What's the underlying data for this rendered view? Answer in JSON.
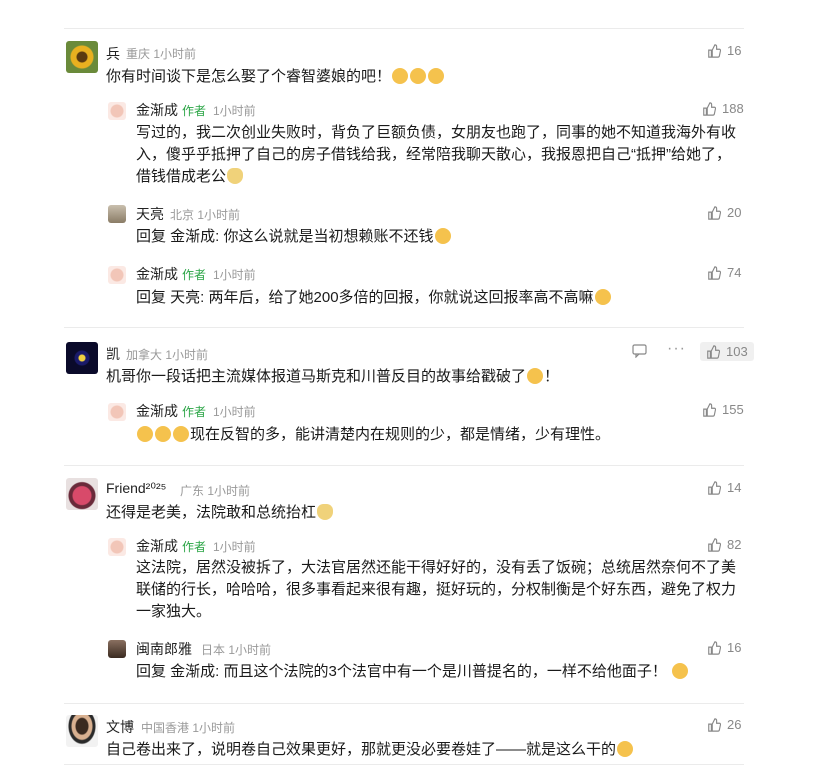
{
  "comments": [
    {
      "name": "兵",
      "location": "重庆",
      "time": "1小时前",
      "likes": "16",
      "text": "你有时间谈下是怎么娶了个睿智婆娘的吧！",
      "replies": [
        {
          "name": "金渐成",
          "tag": "作者",
          "time": "1小时前",
          "likes": "188",
          "lines": [
            "写过的，我二次创业失败时，背负了巨额负债，女朋友也跑了，同事的她不知道我海外有收",
            "入，傻乎乎抵押了自己的房子借钱给我，经常陪我聊天散心，我报恩把自己“抵押”给她了，",
            "借钱借成老公"
          ]
        },
        {
          "name": "天亮",
          "location": "北京",
          "time": "1小时前",
          "likes": "20",
          "reply_prefix": "回复 金渐成:",
          "text": "你这么说就是当初想赖账不还钱"
        },
        {
          "name": "金渐成",
          "tag": "作者",
          "time": "1小时前",
          "likes": "74",
          "reply_prefix": "回复 天亮:",
          "text": "两年后，给了她200多倍的回报，你就说这回报率高不高嘛"
        }
      ]
    },
    {
      "name": "凯",
      "location": "加拿大",
      "time": "1小时前",
      "likes": "103",
      "text": "机哥你一段话把主流媒体报道马斯克和川普反目的故事给戳破了",
      "text_end": "！",
      "replies": [
        {
          "name": "金渐成",
          "tag": "作者",
          "time": "1小时前",
          "likes": "155",
          "text": "现在反智的多，能讲清楚内在规则的少，都是情绪，少有理性。"
        }
      ]
    },
    {
      "name": "Friend²⁰²⁵",
      "location": "广东",
      "time": "1小时前",
      "likes": "14",
      "text": "还得是老美，法院敢和总统抬杠",
      "replies": [
        {
          "name": "金渐成",
          "tag": "作者",
          "time": "1小时前",
          "likes": "82",
          "lines": [
            "这法院，居然没被拆了，大法官居然还能干得好好的，没有丢了饭碗；总统居然奈何不了美",
            "联储的行长，哈哈哈，很多事看起来很有趣，挺好玩的，分权制衡是个好东西，避免了权力",
            "一家独大。"
          ]
        },
        {
          "name": "闽南郎雅",
          "location": "日本",
          "time": "1小时前",
          "likes": "16",
          "reply_prefix": "回复 金渐成:",
          "text": "而且这个法院的3个法官中有一个是川普提名的，一样不给他面子！"
        }
      ]
    },
    {
      "name": "文博",
      "location": "中国香港",
      "time": "1小时前",
      "likes": "26",
      "text": "自己卷出来了，说明卷自己效果更好，那就更没必要卷娃了——就是这么干的"
    }
  ],
  "colors": {
    "author_tag": "#2aa545",
    "meta": "#999999",
    "text": "#1a1a1a"
  }
}
